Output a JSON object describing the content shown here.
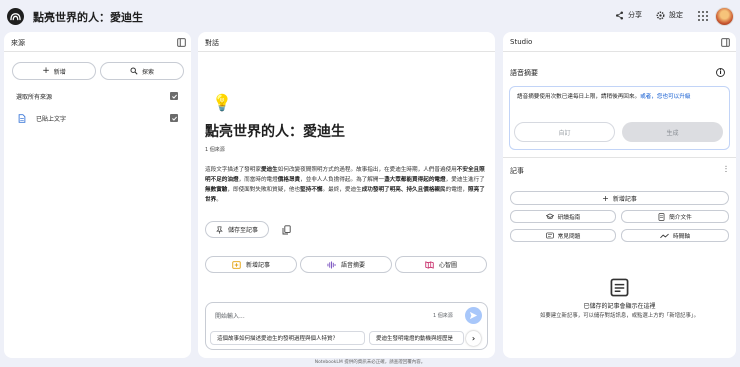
{
  "header": {
    "title": "點亮世界的人：愛迪生",
    "share_label": "分享",
    "settings_label": "設定"
  },
  "sources": {
    "title": "來源",
    "add_label": "新增",
    "discover_label": "探索",
    "select_all_label": "選取所有來源",
    "items": [
      {
        "label": "已貼上文字"
      }
    ]
  },
  "chat": {
    "title": "對話",
    "emoji": "💡",
    "notebook_title": "點亮世界的人：愛迪生",
    "source_count": "1 個來源",
    "summary_parts": [
      {
        "t": "這段文字描述了發明家"
      },
      {
        "t": "愛迪生",
        "b": true
      },
      {
        "t": "如何改變夜間照明方式的過程。故事指出，在愛迪生時期，人們普遍使用"
      },
      {
        "t": "不安全且照明不足的油燈",
        "b": true
      },
      {
        "t": "，而當時的電燈"
      },
      {
        "t": "價格昂貴",
        "b": true
      },
      {
        "t": "，並非人人負擔得起。為了解開一"
      },
      {
        "t": "盞大眾都能買得起的電燈",
        "b": true
      },
      {
        "t": "，愛迪生進行了"
      },
      {
        "t": "無數實驗",
        "b": true
      },
      {
        "t": "，即使面對失敗和質疑，他也"
      },
      {
        "t": "堅持不懈",
        "b": true
      },
      {
        "t": "。最終，愛迪生"
      },
      {
        "t": "成功發明了明亮、持久且價格親民",
        "b": true
      },
      {
        "t": "的電燈，"
      },
      {
        "t": "照亮了世界",
        "b": true
      },
      {
        "t": "。"
      }
    ],
    "save_note_label": "儲存至記事",
    "actions": [
      {
        "label": "新增記事",
        "icon": "note-add-icon"
      },
      {
        "label": "語音摘要",
        "icon": "audio-wave-icon"
      },
      {
        "label": "心智圖",
        "icon": "mindmap-icon"
      }
    ],
    "input_placeholder": "開始輸入...",
    "input_source_count": "1 個來源",
    "suggestions": [
      "這個故事如何描述愛迪生的發明過程與個人特質？",
      "愛迪生發明電燈的動機與經歷是"
    ]
  },
  "studio": {
    "title": "Studio",
    "audio_title": "語音摘要",
    "audio_notice": "語音摘要使用次數已達每日上限，請稍後再回來。",
    "audio_notice_link": "或者，您也可以升級",
    "customize_label": "自訂",
    "generate_label": "生成",
    "notes_title": "記事",
    "add_note_label": "新增記事",
    "note_buttons": [
      {
        "label": "研讀指南",
        "icon": "study-guide-icon"
      },
      {
        "label": "簡介文件",
        "icon": "briefing-doc-icon"
      },
      {
        "label": "常見問題",
        "icon": "faq-icon"
      },
      {
        "label": "時間軸",
        "icon": "timeline-icon"
      }
    ],
    "empty_title": "已儲存的記事會顯示在這裡",
    "empty_desc": "如要建立新記事，可以儲存對話訊息，或點選上方的「新增記事」。"
  },
  "footer": "NotebookLM 提供的資訊未必正確，請查證回覆內容。",
  "colors": {
    "accent": "#0b57d0",
    "send": "#a8c7fa",
    "background": "#eef0f8",
    "panel": "#ffffff",
    "notice_border": "#c2d4f7"
  }
}
